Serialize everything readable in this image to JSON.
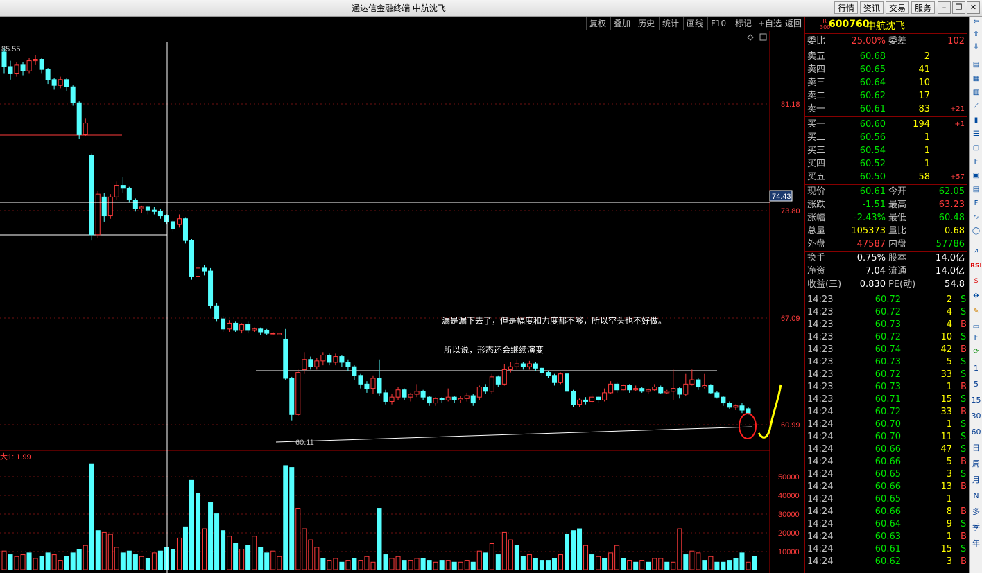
{
  "window": {
    "title": "通达信金融终端  中航沈飞",
    "nav": [
      "行情",
      "资讯",
      "交易",
      "服务"
    ]
  },
  "toolbar": [
    "复权",
    "叠加",
    "历史",
    "统计",
    "画线",
    "F10",
    "标记",
    "+自选",
    "返回"
  ],
  "chart": {
    "top_label": "85.55",
    "low_label": "60.11",
    "volume_label": "大1: 1.99",
    "crosshair_price": "74.43",
    "price_axis": [
      "81.18",
      "73.80",
      "67.09",
      "60.99"
    ],
    "volume_axis": [
      "50000",
      "40000",
      "30000",
      "20000",
      "10000"
    ],
    "annotation_1": "漏是漏下去了，但是幅度和力度都不够，所以空头也不好做。",
    "annotation_2": "所以说，形态还会继续演变",
    "colors": {
      "up": "#ff3b3b",
      "down": "#54ffff",
      "annotation": "#ffff00",
      "circle": "#ff2020"
    }
  },
  "quote": {
    "code": "600760",
    "name": "中航沈飞",
    "badge_top": "R",
    "badge_bottom": "300",
    "weibi_label": "委比",
    "weibi": "25.00%",
    "weicha_label": "委差",
    "weicha": "102",
    "sells": [
      {
        "label": "卖五",
        "price": "60.68",
        "vol": "2",
        "chg": ""
      },
      {
        "label": "卖四",
        "price": "60.65",
        "vol": "41",
        "chg": ""
      },
      {
        "label": "卖三",
        "price": "60.64",
        "vol": "10",
        "chg": ""
      },
      {
        "label": "卖二",
        "price": "60.62",
        "vol": "17",
        "chg": ""
      },
      {
        "label": "卖一",
        "price": "60.61",
        "vol": "83",
        "chg": "+21"
      }
    ],
    "buys": [
      {
        "label": "买一",
        "price": "60.60",
        "vol": "194",
        "chg": "+1"
      },
      {
        "label": "买二",
        "price": "60.56",
        "vol": "1",
        "chg": ""
      },
      {
        "label": "买三",
        "price": "60.54",
        "vol": "1",
        "chg": ""
      },
      {
        "label": "买四",
        "price": "60.52",
        "vol": "1",
        "chg": ""
      },
      {
        "label": "买五",
        "price": "60.50",
        "vol": "58",
        "chg": "+57"
      }
    ],
    "stats": [
      {
        "l1": "现价",
        "v1": "60.61",
        "c1": "green",
        "l2": "今开",
        "v2": "62.05",
        "c2": "green"
      },
      {
        "l1": "涨跌",
        "v1": "-1.51",
        "c1": "green",
        "l2": "最高",
        "v2": "63.23",
        "c2": "red"
      },
      {
        "l1": "涨幅",
        "v1": "-2.43%",
        "c1": "green",
        "l2": "最低",
        "v2": "60.48",
        "c2": "green"
      },
      {
        "l1": "总量",
        "v1": "105373",
        "c1": "yellow",
        "l2": "量比",
        "v2": "0.68",
        "c2": "yellow"
      },
      {
        "l1": "外盘",
        "v1": "47587",
        "c1": "red",
        "l2": "内盘",
        "v2": "57786",
        "c2": "green"
      }
    ],
    "fund": [
      {
        "l1": "换手",
        "v1": "0.75%",
        "l2": "股本",
        "v2": "14.0亿"
      },
      {
        "l1": "净资",
        "v1": "7.04",
        "l2": "流通",
        "v2": "14.0亿"
      },
      {
        "l1": "收益(三)",
        "v1": "0.830",
        "l2": "PE(动)",
        "v2": "54.8"
      }
    ]
  },
  "ticks": [
    {
      "time": "14:23",
      "price": "60.72",
      "vol": "2",
      "dir": "S"
    },
    {
      "time": "14:23",
      "price": "60.72",
      "vol": "4",
      "dir": "S"
    },
    {
      "time": "14:23",
      "price": "60.73",
      "vol": "4",
      "dir": "B"
    },
    {
      "time": "14:23",
      "price": "60.72",
      "vol": "10",
      "dir": "S"
    },
    {
      "time": "14:23",
      "price": "60.74",
      "vol": "42",
      "dir": "B"
    },
    {
      "time": "14:23",
      "price": "60.73",
      "vol": "5",
      "dir": "S"
    },
    {
      "time": "14:23",
      "price": "60.72",
      "vol": "33",
      "dir": "S"
    },
    {
      "time": "14:23",
      "price": "60.73",
      "vol": "1",
      "dir": "B"
    },
    {
      "time": "14:23",
      "price": "60.71",
      "vol": "15",
      "dir": "S"
    },
    {
      "time": "14:24",
      "price": "60.72",
      "vol": "33",
      "dir": "B"
    },
    {
      "time": "14:24",
      "price": "60.70",
      "vol": "1",
      "dir": "S"
    },
    {
      "time": "14:24",
      "price": "60.70",
      "vol": "11",
      "dir": "S"
    },
    {
      "time": "14:24",
      "price": "60.66",
      "vol": "47",
      "dir": "S"
    },
    {
      "time": "14:24",
      "price": "60.66",
      "vol": "5",
      "dir": "B"
    },
    {
      "time": "14:24",
      "price": "60.65",
      "vol": "3",
      "dir": "S"
    },
    {
      "time": "14:24",
      "price": "60.66",
      "vol": "13",
      "dir": "B"
    },
    {
      "time": "14:24",
      "price": "60.65",
      "vol": "1",
      "dir": ""
    },
    {
      "time": "14:24",
      "price": "60.66",
      "vol": "8",
      "dir": "B"
    },
    {
      "time": "14:24",
      "price": "60.64",
      "vol": "9",
      "dir": "S"
    },
    {
      "time": "14:24",
      "price": "60.63",
      "vol": "1",
      "dir": "B"
    },
    {
      "time": "14:24",
      "price": "60.61",
      "vol": "15",
      "dir": "S"
    },
    {
      "time": "14:24",
      "price": "60.62",
      "vol": "3",
      "dir": "B"
    }
  ],
  "sidebar": [
    "1",
    "5",
    "15",
    "30",
    "60",
    "日",
    "周",
    "月",
    "N",
    "多",
    "季",
    "年"
  ],
  "candles": [
    [
      85.5,
      84.5,
      85.8,
      84.0
    ],
    [
      84.5,
      84.0,
      84.9,
      83.6
    ],
    [
      84.0,
      84.6,
      84.8,
      83.8
    ],
    [
      84.6,
      84.2,
      84.8,
      83.9
    ],
    [
      84.2,
      84.9,
      85.1,
      84.0
    ],
    [
      84.9,
      85.0,
      85.3,
      84.6
    ],
    [
      85.0,
      84.3,
      85.1,
      84.0
    ],
    [
      84.3,
      83.6,
      84.4,
      83.3
    ],
    [
      83.6,
      83.2,
      83.7,
      82.9
    ],
    [
      83.2,
      83.6,
      83.8,
      83.0
    ],
    [
      83.6,
      83.1,
      83.7,
      82.8
    ],
    [
      83.1,
      82.0,
      83.2,
      81.8
    ],
    [
      82.0,
      79.8,
      82.1,
      79.5
    ],
    [
      79.8,
      80.6,
      80.9,
      79.7
    ],
    [
      78.4,
      72.9,
      78.5,
      72.5
    ],
    [
      72.9,
      75.7,
      75.9,
      72.7
    ],
    [
      75.5,
      74.2,
      75.8,
      73.8
    ],
    [
      74.2,
      75.5,
      75.7,
      74.0
    ],
    [
      75.5,
      76.3,
      76.6,
      75.3
    ],
    [
      76.3,
      76.1,
      76.9,
      75.8
    ],
    [
      76.1,
      75.3,
      76.2,
      75.1
    ],
    [
      75.3,
      74.7,
      75.4,
      74.5
    ],
    [
      74.7,
      74.8,
      74.9,
      74.4
    ],
    [
      74.8,
      74.6,
      74.9,
      74.3
    ],
    [
      74.6,
      74.5,
      74.8,
      74.3
    ],
    [
      74.5,
      74.2,
      74.7,
      74.0
    ],
    [
      74.2,
      73.8,
      74.3,
      73.6
    ],
    [
      73.8,
      73.3,
      73.9,
      73.1
    ],
    [
      73.6,
      74.0,
      74.3,
      73.4
    ],
    [
      74.0,
      72.5,
      74.1,
      72.3
    ],
    [
      72.5,
      70.0,
      72.6,
      69.8
    ],
    [
      70.0,
      70.6,
      70.8,
      69.8
    ],
    [
      70.6,
      70.4,
      70.8,
      70.1
    ],
    [
      70.4,
      68.0,
      70.6,
      67.8
    ],
    [
      68.0,
      67.1,
      68.2,
      66.9
    ],
    [
      67.1,
      66.4,
      67.3,
      66.2
    ],
    [
      66.4,
      66.8,
      67.0,
      66.2
    ],
    [
      66.8,
      66.3,
      66.9,
      66.2
    ],
    [
      66.3,
      66.7,
      66.8,
      66.1
    ],
    [
      66.7,
      66.3,
      66.9,
      66.1
    ],
    [
      66.3,
      66.4,
      66.5,
      66.2
    ],
    [
      66.4,
      66.2,
      66.5,
      66.0
    ],
    [
      66.3,
      66.1,
      66.4,
      66.0
    ],
    [
      66.1,
      66.1,
      66.2,
      66.0
    ],
    [
      66.0,
      66.1,
      66.1,
      66.0
    ],
    [
      65.7,
      63.0,
      66.4,
      62.9
    ],
    [
      63.0,
      60.5,
      63.1,
      60.1
    ],
    [
      60.5,
      63.4,
      63.6,
      60.4
    ],
    [
      63.6,
      64.3,
      64.8,
      63.3
    ],
    [
      64.3,
      63.8,
      64.5,
      63.6
    ],
    [
      63.8,
      64.2,
      64.4,
      63.6
    ],
    [
      64.2,
      64.6,
      64.8,
      63.9
    ],
    [
      64.6,
      64.1,
      64.7,
      63.9
    ],
    [
      64.1,
      64.5,
      64.7,
      63.9
    ],
    [
      64.5,
      64.1,
      64.6,
      63.8
    ],
    [
      64.1,
      63.8,
      64.3,
      63.5
    ],
    [
      63.8,
      63.2,
      63.9,
      62.9
    ],
    [
      63.2,
      62.6,
      63.3,
      62.3
    ],
    [
      62.6,
      62.3,
      62.8,
      62.0
    ],
    [
      62.3,
      63.0,
      63.2,
      61.9
    ],
    [
      63.0,
      62.0,
      64.3,
      61.8
    ],
    [
      62.0,
      61.4,
      62.2,
      61.2
    ],
    [
      61.4,
      61.7,
      61.9,
      61.2
    ],
    [
      61.7,
      62.2,
      62.4,
      61.5
    ],
    [
      62.2,
      61.7,
      62.3,
      61.5
    ],
    [
      61.7,
      61.9,
      62.0,
      61.4
    ],
    [
      61.9,
      62.1,
      62.6,
      61.7
    ],
    [
      62.1,
      61.7,
      62.2,
      61.5
    ],
    [
      61.7,
      61.3,
      61.8,
      61.1
    ],
    [
      61.3,
      61.6,
      61.7,
      61.1
    ],
    [
      61.6,
      61.5,
      61.7,
      61.3
    ],
    [
      61.5,
      61.7,
      62.3,
      61.4
    ],
    [
      61.7,
      61.5,
      61.8,
      61.3
    ],
    [
      61.5,
      61.6,
      61.8,
      61.3
    ],
    [
      61.6,
      61.8,
      62.0,
      61.4
    ],
    [
      61.8,
      61.3,
      61.9,
      61.1
    ],
    [
      61.7,
      62.4,
      62.5,
      61.5
    ],
    [
      62.4,
      62.1,
      62.6,
      61.9
    ],
    [
      62.1,
      63.1,
      63.3,
      61.9
    ],
    [
      63.1,
      62.6,
      63.2,
      62.4
    ],
    [
      62.6,
      63.6,
      64.0,
      62.5
    ],
    [
      63.6,
      63.8,
      64.1,
      63.4
    ],
    [
      63.8,
      64.0,
      64.3,
      63.6
    ],
    [
      64.0,
      63.8,
      64.1,
      63.6
    ],
    [
      63.8,
      64.0,
      64.2,
      63.6
    ],
    [
      64.0,
      63.7,
      64.1,
      63.5
    ],
    [
      63.7,
      63.4,
      63.8,
      63.2
    ],
    [
      63.4,
      63.2,
      63.5,
      63.0
    ],
    [
      63.2,
      62.7,
      63.3,
      62.5
    ],
    [
      62.7,
      63.3,
      63.4,
      62.6
    ],
    [
      63.3,
      62.1,
      63.4,
      61.9
    ],
    [
      62.1,
      61.2,
      62.2,
      61.0
    ],
    [
      61.2,
      61.5,
      61.6,
      61.0
    ],
    [
      61.5,
      61.4,
      61.7,
      61.2
    ],
    [
      61.4,
      61.7,
      61.9,
      61.3
    ],
    [
      61.7,
      61.5,
      61.8,
      61.3
    ],
    [
      61.5,
      62.0,
      62.3,
      61.4
    ],
    [
      62.0,
      62.6,
      62.8,
      61.9
    ],
    [
      62.6,
      62.2,
      62.7,
      62.0
    ],
    [
      62.2,
      62.5,
      62.6,
      62.1
    ],
    [
      62.5,
      62.2,
      62.6,
      62.0
    ],
    [
      62.2,
      62.3,
      62.5,
      62.1
    ],
    [
      62.3,
      62.1,
      62.4,
      62.0
    ],
    [
      62.1,
      62.2,
      62.3,
      61.9
    ],
    [
      62.2,
      62.4,
      62.6,
      62.1
    ],
    [
      62.4,
      62.0,
      62.5,
      61.9
    ],
    [
      62.0,
      62.1,
      62.2,
      61.9
    ],
    [
      62.1,
      62.3,
      63.6,
      61.5
    ],
    [
      62.3,
      61.9,
      62.4,
      61.6
    ],
    [
      61.9,
      62.6,
      63.3,
      61.8
    ],
    [
      62.6,
      62.9,
      63.6,
      62.5
    ],
    [
      62.9,
      62.4,
      63.0,
      62.2
    ],
    [
      62.4,
      62.5,
      63.3,
      62.3
    ],
    [
      62.5,
      62.0,
      62.6,
      61.9
    ],
    [
      62.0,
      61.7,
      62.1,
      61.6
    ],
    [
      61.7,
      61.3,
      61.8,
      61.1
    ],
    [
      61.3,
      61.0,
      61.4,
      60.9
    ],
    [
      61.0,
      61.1,
      61.2,
      60.8
    ],
    [
      61.1,
      60.8,
      61.3,
      60.6
    ],
    [
      60.9,
      60.6,
      61.0,
      60.5
    ]
  ],
  "volumes": [
    [
      10,
      1
    ],
    [
      8,
      0
    ],
    [
      7,
      1
    ],
    [
      8,
      1
    ],
    [
      9,
      0
    ],
    [
      6,
      1
    ],
    [
      7,
      0
    ],
    [
      9,
      0
    ],
    [
      8,
      1
    ],
    [
      5,
      1
    ],
    [
      7,
      0
    ],
    [
      9,
      0
    ],
    [
      11,
      0
    ],
    [
      13,
      1
    ],
    [
      57,
      0
    ],
    [
      21,
      0
    ],
    [
      20,
      1
    ],
    [
      19,
      1
    ],
    [
      12,
      1
    ],
    [
      9,
      0
    ],
    [
      10,
      0
    ],
    [
      8,
      0
    ],
    [
      7,
      1
    ],
    [
      6,
      0
    ],
    [
      9,
      1
    ],
    [
      10,
      0
    ],
    [
      12,
      0
    ],
    [
      11,
      0
    ],
    [
      17,
      1
    ],
    [
      23,
      0
    ],
    [
      48,
      0
    ],
    [
      41,
      0
    ],
    [
      22,
      1
    ],
    [
      36,
      0
    ],
    [
      30,
      0
    ],
    [
      21,
      0
    ],
    [
      18,
      1
    ],
    [
      14,
      0
    ],
    [
      11,
      1
    ],
    [
      13,
      0
    ],
    [
      18,
      1
    ],
    [
      12,
      0
    ],
    [
      9,
      0
    ],
    [
      10,
      1
    ],
    [
      7,
      1
    ],
    [
      56,
      0
    ],
    [
      55,
      0
    ],
    [
      33,
      1
    ],
    [
      22,
      1
    ],
    [
      16,
      1
    ],
    [
      12,
      1
    ],
    [
      6,
      0
    ],
    [
      5,
      1
    ],
    [
      6,
      1
    ],
    [
      4,
      0
    ],
    [
      5,
      1
    ],
    [
      6,
      0
    ],
    [
      5,
      1
    ],
    [
      7,
      1
    ],
    [
      4,
      1
    ],
    [
      33,
      0
    ],
    [
      8,
      0
    ],
    [
      6,
      1
    ],
    [
      7,
      1
    ],
    [
      5,
      0
    ],
    [
      5,
      1
    ],
    [
      6,
      1
    ],
    [
      6,
      0
    ],
    [
      5,
      0
    ],
    [
      4,
      1
    ],
    [
      5,
      0
    ],
    [
      5,
      1
    ],
    [
      4,
      0
    ],
    [
      4,
      1
    ],
    [
      5,
      1
    ],
    [
      4,
      0
    ],
    [
      10,
      1
    ],
    [
      9,
      0
    ],
    [
      14,
      1
    ],
    [
      8,
      0
    ],
    [
      20,
      1
    ],
    [
      16,
      1
    ],
    [
      13,
      0
    ],
    [
      7,
      0
    ],
    [
      8,
      1
    ],
    [
      6,
      0
    ],
    [
      5,
      0
    ],
    [
      5,
      0
    ],
    [
      6,
      0
    ],
    [
      8,
      1
    ],
    [
      19,
      0
    ],
    [
      21,
      0
    ],
    [
      22,
      0
    ],
    [
      13,
      1
    ],
    [
      8,
      0
    ],
    [
      7,
      1
    ],
    [
      6,
      0
    ],
    [
      9,
      1
    ],
    [
      13,
      1
    ],
    [
      6,
      0
    ],
    [
      5,
      1
    ],
    [
      4,
      0
    ],
    [
      5,
      1
    ],
    [
      4,
      0
    ],
    [
      6,
      1
    ],
    [
      6,
      1
    ],
    [
      4,
      0
    ],
    [
      4,
      1
    ],
    [
      22,
      1
    ],
    [
      8,
      0
    ],
    [
      10,
      1
    ],
    [
      9,
      1
    ],
    [
      5,
      0
    ],
    [
      7,
      1
    ],
    [
      4,
      0
    ],
    [
      4,
      0
    ],
    [
      5,
      0
    ],
    [
      6,
      0
    ],
    [
      9,
      0
    ],
    [
      4,
      1
    ],
    [
      7,
      0
    ]
  ]
}
